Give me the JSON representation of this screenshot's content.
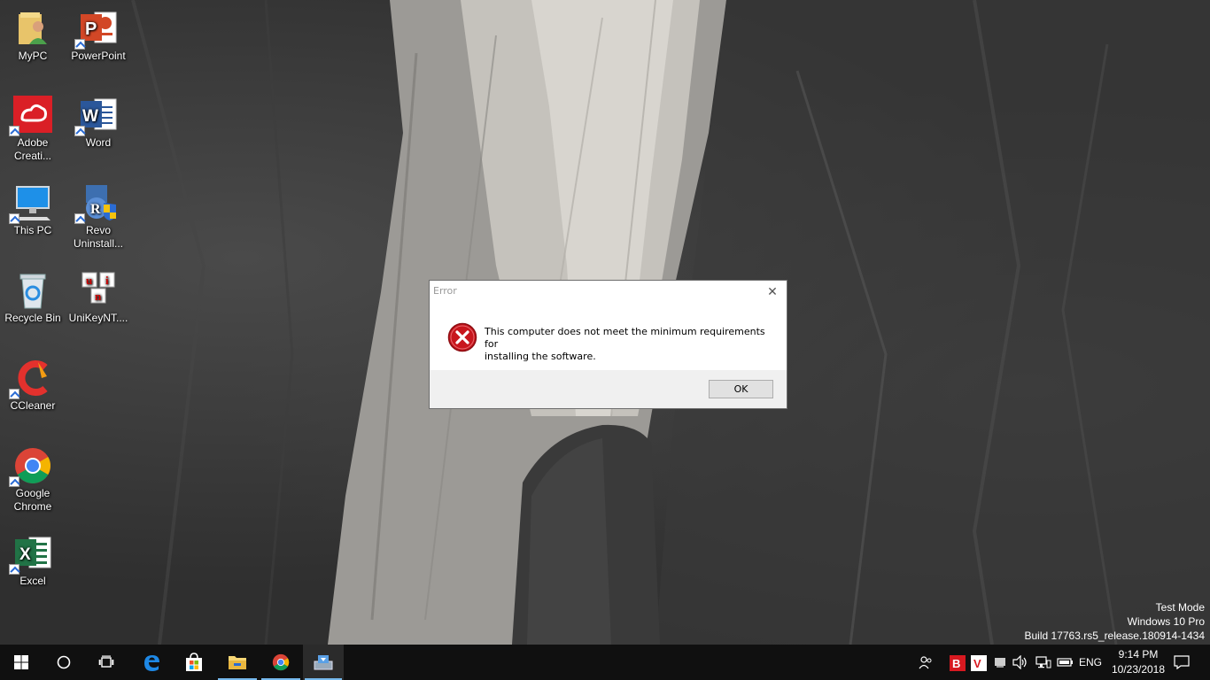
{
  "desktop": {
    "icons": [
      {
        "label": "MyPC"
      },
      {
        "label": "PowerPoint"
      },
      {
        "label": "Adobe Creati..."
      },
      {
        "label": "Word"
      },
      {
        "label": "This PC"
      },
      {
        "label": "Revo Uninstall..."
      },
      {
        "label": "Recycle Bin"
      },
      {
        "label": "UniKeyNT...."
      },
      {
        "label": "CCleaner"
      },
      {
        "label": "Google Chrome"
      },
      {
        "label": "Excel"
      }
    ]
  },
  "dialog": {
    "title": "Error",
    "message_line1": "This computer does not meet the minimum requirements for",
    "message_line2": "installing the software.",
    "ok_label": "OK",
    "close_glyph": "✕"
  },
  "watermark": {
    "line1": "Test Mode",
    "line2": "Windows 10 Pro",
    "line3": "Build 17763.rs5_release.180914-1434"
  },
  "taskbar": {
    "language": "ENG",
    "time": "9:14 PM",
    "date": "10/23/2018"
  },
  "colors": {
    "taskbar_bg": "#101010",
    "accent": "#76b9ed",
    "error_red": "#c8161d"
  }
}
